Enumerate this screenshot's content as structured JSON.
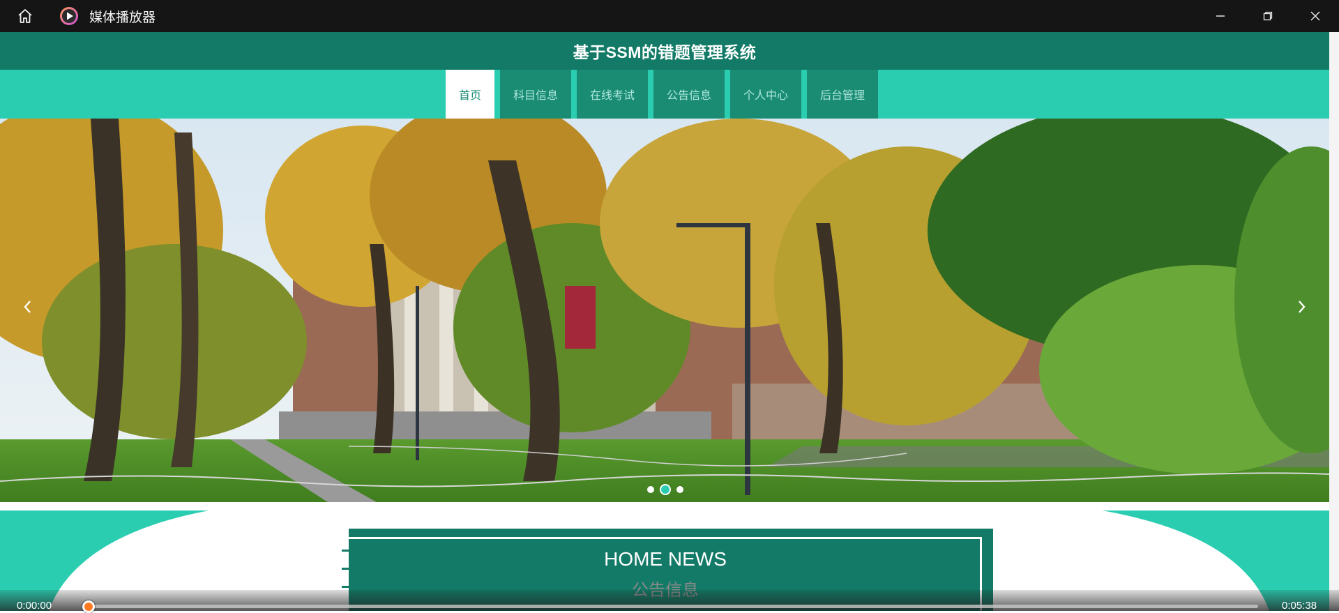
{
  "player": {
    "title": "媒体播放器",
    "icons": {
      "home": "home-icon",
      "app": "play-circle-icon",
      "minimize": "minimize-icon",
      "restore": "restore-icon",
      "close": "close-icon"
    },
    "current_time": "0:00:00",
    "total_time": "0:05:38",
    "progress_fraction": 0.0,
    "accent_color": "#ff7a20"
  },
  "site": {
    "title": "基于SSM的错题管理系统",
    "colors": {
      "header": "#127a66",
      "nav": "#2bcdb1",
      "nav_item": "#1a8c74",
      "active_item": "#ffffff"
    },
    "nav": [
      {
        "label": "首页",
        "active": true
      },
      {
        "label": "科目信息",
        "active": false
      },
      {
        "label": "在线考试",
        "active": false
      },
      {
        "label": "公告信息",
        "active": false
      },
      {
        "label": "个人中心",
        "active": false
      },
      {
        "label": "后台管理",
        "active": false
      }
    ],
    "carousel": {
      "slide_count": 3,
      "active_index": 1,
      "prev_icon": "chevron-left-icon",
      "next_icon": "chevron-right-icon"
    },
    "news": {
      "title": "HOME NEWS",
      "subtitle": "公告信息"
    }
  }
}
